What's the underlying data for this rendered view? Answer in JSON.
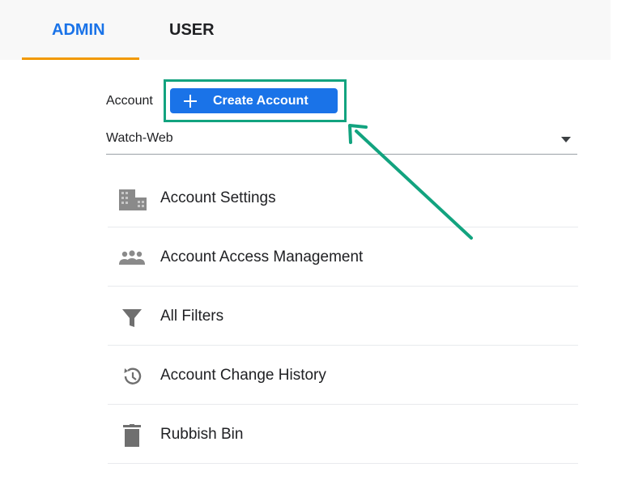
{
  "tabs": [
    {
      "label": "ADMIN"
    },
    {
      "label": "USER"
    }
  ],
  "account": {
    "label": "Account",
    "create_button_label": "Create Account",
    "selected_account": "Watch-Web"
  },
  "menu": {
    "items": [
      {
        "label": "Account Settings",
        "icon": "building-icon"
      },
      {
        "label": "Account Access Management",
        "icon": "people-icon"
      },
      {
        "label": "All Filters",
        "icon": "filter-icon"
      },
      {
        "label": "Account Change History",
        "icon": "history-icon"
      },
      {
        "label": "Rubbish Bin",
        "icon": "trash-icon"
      }
    ]
  },
  "colors": {
    "accent": "#1a73e8",
    "tab_indicator": "#f29900",
    "highlight": "#12a37f",
    "icon": "#7f7f7f"
  }
}
